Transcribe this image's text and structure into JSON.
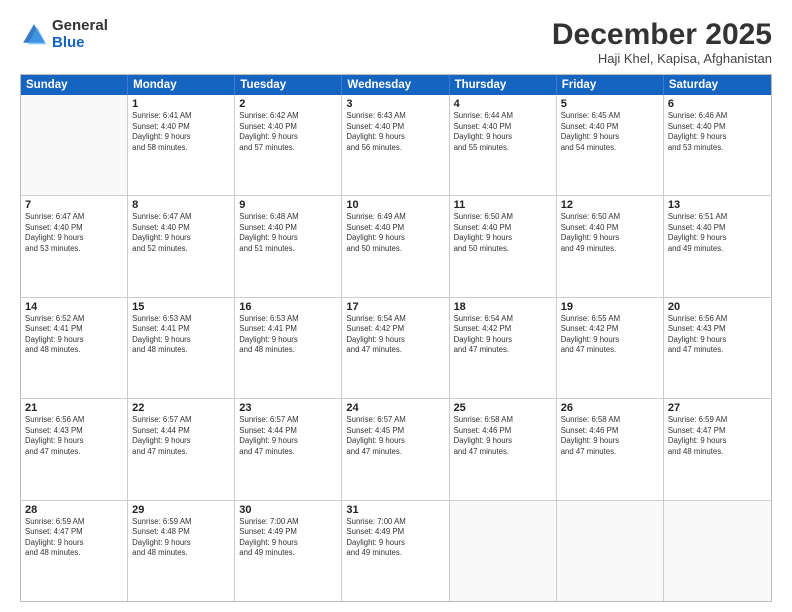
{
  "header": {
    "logo_general": "General",
    "logo_blue": "Blue",
    "month_title": "December 2025",
    "location": "Haji Khel, Kapisa, Afghanistan"
  },
  "calendar": {
    "days_of_week": [
      "Sunday",
      "Monday",
      "Tuesday",
      "Wednesday",
      "Thursday",
      "Friday",
      "Saturday"
    ],
    "weeks": [
      [
        {
          "day": "",
          "info": ""
        },
        {
          "day": "1",
          "info": "Sunrise: 6:41 AM\nSunset: 4:40 PM\nDaylight: 9 hours\nand 58 minutes."
        },
        {
          "day": "2",
          "info": "Sunrise: 6:42 AM\nSunset: 4:40 PM\nDaylight: 9 hours\nand 57 minutes."
        },
        {
          "day": "3",
          "info": "Sunrise: 6:43 AM\nSunset: 4:40 PM\nDaylight: 9 hours\nand 56 minutes."
        },
        {
          "day": "4",
          "info": "Sunrise: 6:44 AM\nSunset: 4:40 PM\nDaylight: 9 hours\nand 55 minutes."
        },
        {
          "day": "5",
          "info": "Sunrise: 6:45 AM\nSunset: 4:40 PM\nDaylight: 9 hours\nand 54 minutes."
        },
        {
          "day": "6",
          "info": "Sunrise: 6:46 AM\nSunset: 4:40 PM\nDaylight: 9 hours\nand 53 minutes."
        }
      ],
      [
        {
          "day": "7",
          "info": "Sunrise: 6:47 AM\nSunset: 4:40 PM\nDaylight: 9 hours\nand 53 minutes."
        },
        {
          "day": "8",
          "info": "Sunrise: 6:47 AM\nSunset: 4:40 PM\nDaylight: 9 hours\nand 52 minutes."
        },
        {
          "day": "9",
          "info": "Sunrise: 6:48 AM\nSunset: 4:40 PM\nDaylight: 9 hours\nand 51 minutes."
        },
        {
          "day": "10",
          "info": "Sunrise: 6:49 AM\nSunset: 4:40 PM\nDaylight: 9 hours\nand 50 minutes."
        },
        {
          "day": "11",
          "info": "Sunrise: 6:50 AM\nSunset: 4:40 PM\nDaylight: 9 hours\nand 50 minutes."
        },
        {
          "day": "12",
          "info": "Sunrise: 6:50 AM\nSunset: 4:40 PM\nDaylight: 9 hours\nand 49 minutes."
        },
        {
          "day": "13",
          "info": "Sunrise: 6:51 AM\nSunset: 4:40 PM\nDaylight: 9 hours\nand 49 minutes."
        }
      ],
      [
        {
          "day": "14",
          "info": "Sunrise: 6:52 AM\nSunset: 4:41 PM\nDaylight: 9 hours\nand 48 minutes."
        },
        {
          "day": "15",
          "info": "Sunrise: 6:53 AM\nSunset: 4:41 PM\nDaylight: 9 hours\nand 48 minutes."
        },
        {
          "day": "16",
          "info": "Sunrise: 6:53 AM\nSunset: 4:41 PM\nDaylight: 9 hours\nand 48 minutes."
        },
        {
          "day": "17",
          "info": "Sunrise: 6:54 AM\nSunset: 4:42 PM\nDaylight: 9 hours\nand 47 minutes."
        },
        {
          "day": "18",
          "info": "Sunrise: 6:54 AM\nSunset: 4:42 PM\nDaylight: 9 hours\nand 47 minutes."
        },
        {
          "day": "19",
          "info": "Sunrise: 6:55 AM\nSunset: 4:42 PM\nDaylight: 9 hours\nand 47 minutes."
        },
        {
          "day": "20",
          "info": "Sunrise: 6:56 AM\nSunset: 4:43 PM\nDaylight: 9 hours\nand 47 minutes."
        }
      ],
      [
        {
          "day": "21",
          "info": "Sunrise: 6:56 AM\nSunset: 4:43 PM\nDaylight: 9 hours\nand 47 minutes."
        },
        {
          "day": "22",
          "info": "Sunrise: 6:57 AM\nSunset: 4:44 PM\nDaylight: 9 hours\nand 47 minutes."
        },
        {
          "day": "23",
          "info": "Sunrise: 6:57 AM\nSunset: 4:44 PM\nDaylight: 9 hours\nand 47 minutes."
        },
        {
          "day": "24",
          "info": "Sunrise: 6:57 AM\nSunset: 4:45 PM\nDaylight: 9 hours\nand 47 minutes."
        },
        {
          "day": "25",
          "info": "Sunrise: 6:58 AM\nSunset: 4:46 PM\nDaylight: 9 hours\nand 47 minutes."
        },
        {
          "day": "26",
          "info": "Sunrise: 6:58 AM\nSunset: 4:46 PM\nDaylight: 9 hours\nand 47 minutes."
        },
        {
          "day": "27",
          "info": "Sunrise: 6:59 AM\nSunset: 4:47 PM\nDaylight: 9 hours\nand 48 minutes."
        }
      ],
      [
        {
          "day": "28",
          "info": "Sunrise: 6:59 AM\nSunset: 4:47 PM\nDaylight: 9 hours\nand 48 minutes."
        },
        {
          "day": "29",
          "info": "Sunrise: 6:59 AM\nSunset: 4:48 PM\nDaylight: 9 hours\nand 48 minutes."
        },
        {
          "day": "30",
          "info": "Sunrise: 7:00 AM\nSunset: 4:49 PM\nDaylight: 9 hours\nand 49 minutes."
        },
        {
          "day": "31",
          "info": "Sunrise: 7:00 AM\nSunset: 4:49 PM\nDaylight: 9 hours\nand 49 minutes."
        },
        {
          "day": "",
          "info": ""
        },
        {
          "day": "",
          "info": ""
        },
        {
          "day": "",
          "info": ""
        }
      ]
    ]
  }
}
